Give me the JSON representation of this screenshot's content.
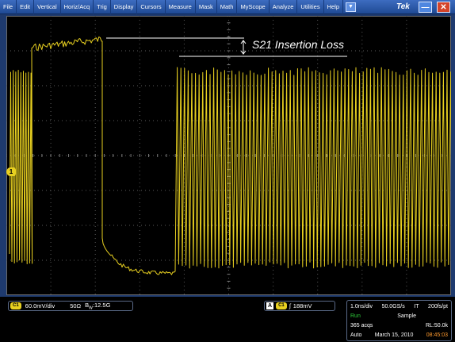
{
  "menu": {
    "items": [
      "File",
      "Edit",
      "Vertical",
      "Horiz/Acq",
      "Trig",
      "Display",
      "Cursors",
      "Measure",
      "Mask",
      "Math",
      "MyScope",
      "Analyze",
      "Utilities",
      "Help"
    ],
    "dropdown_icon": "down-arrow-icon",
    "brand": "Tek",
    "minimize_icon": "minimize-icon",
    "close_icon": "close-icon"
  },
  "display": {
    "annotation": "S21 Insertion Loss",
    "channel_marker": "1",
    "trace_color": "#e8d020"
  },
  "status": {
    "channel": {
      "badge": "C1",
      "scale": "60.0mV/div",
      "impedance": "50Ω",
      "bw_symbol": "B",
      "bw_sub": "W",
      "bandwidth": ":12.5G"
    },
    "trigger": {
      "mode": "A",
      "badge": "C1",
      "slope": "∫",
      "level": "188mV"
    },
    "acquisition": {
      "timebase": "1.0ns/div",
      "sample_rate": "50.0GS/s",
      "it": "IT",
      "resolution": "200fs/pt",
      "run_state": "Run",
      "acq_mode": "Sample",
      "acq_count": "365 acqs",
      "record_length": "RL:50.0k",
      "trigger_mode": "Auto",
      "date": "March 15, 2010",
      "time": "08:45:03"
    }
  }
}
